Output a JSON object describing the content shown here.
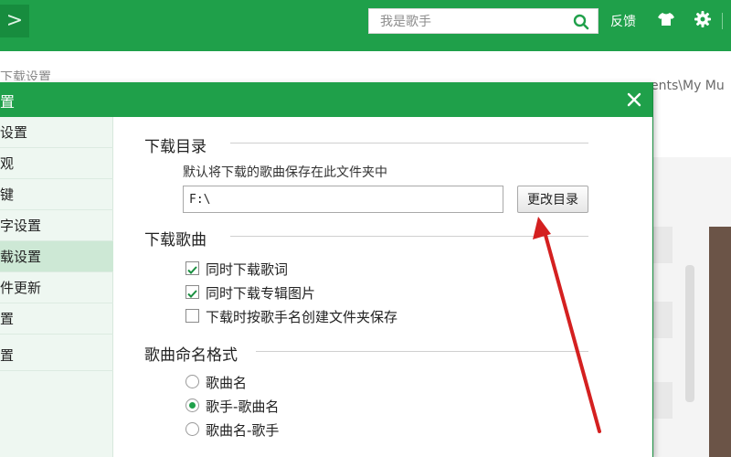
{
  "app": {
    "search_placeholder": "我是歌手",
    "feedback_label": "反馈",
    "nav_arrow": ">"
  },
  "background": {
    "heading_fragment": "下载设置",
    "path_fragment": "ents\\My Mu"
  },
  "dialog": {
    "title": "设置",
    "sidebar": [
      {
        "label": "常规设置"
      },
      {
        "label": "外观"
      },
      {
        "label": "快捷键"
      },
      {
        "label": "歌词字设置"
      },
      {
        "label": "下载设置"
      },
      {
        "label": "软件更新"
      },
      {
        "label": "网络设置"
      },
      {
        "label": "其他设置"
      }
    ],
    "download_dir": {
      "title": "下载目录",
      "description": "默认将下载的歌曲保存在此文件夹中",
      "path": "F:\\",
      "change_button": "更改目录"
    },
    "download_song": {
      "title": "下载歌曲",
      "options": [
        {
          "label": "同时下载歌词",
          "checked": true
        },
        {
          "label": "同时下载专辑图片",
          "checked": true
        },
        {
          "label": "下载时按歌手名创建文件夹保存",
          "checked": false
        }
      ]
    },
    "naming": {
      "title": "歌曲命名格式",
      "options": [
        {
          "label": "歌曲名",
          "selected": false
        },
        {
          "label": "歌手-歌曲名",
          "selected": true
        },
        {
          "label": "歌曲名-歌手",
          "selected": false
        }
      ]
    }
  },
  "colors": {
    "brand_green": "#1fa04a",
    "annotation_arrow": "#d42020"
  }
}
